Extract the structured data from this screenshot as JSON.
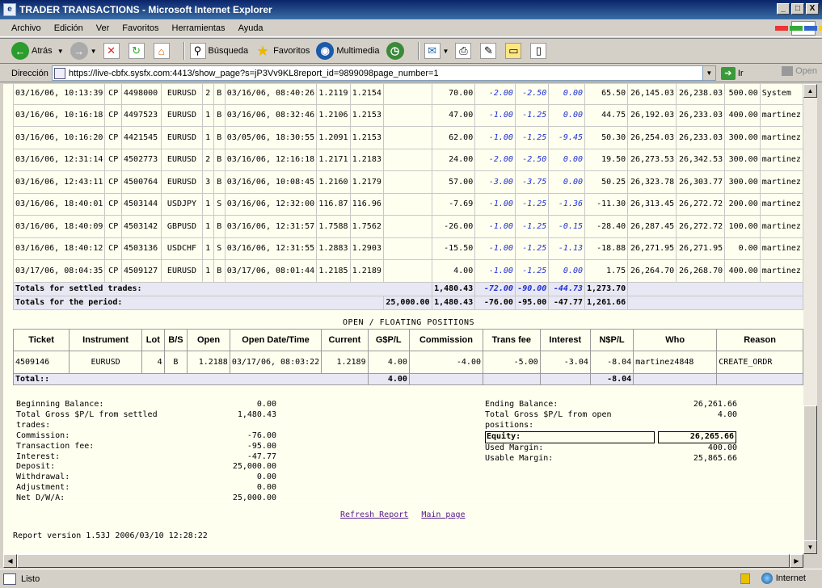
{
  "window": {
    "title": "TRADER TRANSACTIONS - Microsoft Internet Explorer",
    "btn_min": "_",
    "btn_max": "□",
    "btn_close": "X"
  },
  "menu": [
    "Archivo",
    "Edición",
    "Ver",
    "Favoritos",
    "Herramientas",
    "Ayuda"
  ],
  "toolbar": {
    "back": "Atrás",
    "search": "Búsqueda",
    "favorites": "Favoritos",
    "media": "Multimedia"
  },
  "address": {
    "label": "Dirección",
    "url": "https://live-cbfx.sysfx.com:4413/show_page?s=jP3Vv9KL8report_id=9899098page_number=1",
    "go": "Ir",
    "open": "Open"
  },
  "trades": [
    [
      "03/16/06, 10:13:39",
      "CP",
      "4498000",
      "EURUSD",
      "2",
      "B",
      "03/16/06, 08:40:26",
      "1.2119",
      "1.2154",
      "",
      "70.00",
      "-2.00",
      "-2.50",
      "0.00",
      "65.50",
      "26,145.03",
      "26,238.03",
      "500.00",
      "System"
    ],
    [
      "03/16/06, 10:16:18",
      "CP",
      "4497523",
      "EURUSD",
      "1",
      "B",
      "03/16/06, 08:32:46",
      "1.2106",
      "1.2153",
      "",
      "47.00",
      "-1.00",
      "-1.25",
      "0.00",
      "44.75",
      "26,192.03",
      "26,233.03",
      "400.00",
      "martinez"
    ],
    [
      "03/16/06, 10:16:20",
      "CP",
      "4421545",
      "EURUSD",
      "1",
      "B",
      "03/05/06, 18:30:55",
      "1.2091",
      "1.2153",
      "",
      "62.00",
      "-1.00",
      "-1.25",
      "-9.45",
      "50.30",
      "26,254.03",
      "26,233.03",
      "300.00",
      "martinez"
    ],
    [
      "03/16/06, 12:31:14",
      "CP",
      "4502773",
      "EURUSD",
      "2",
      "B",
      "03/16/06, 12:16:18",
      "1.2171",
      "1.2183",
      "",
      "24.00",
      "-2.00",
      "-2.50",
      "0.00",
      "19.50",
      "26,273.53",
      "26,342.53",
      "300.00",
      "martinez"
    ],
    [
      "03/16/06, 12:43:11",
      "CP",
      "4500764",
      "EURUSD",
      "3",
      "B",
      "03/16/06, 10:08:45",
      "1.2160",
      "1.2179",
      "",
      "57.00",
      "-3.00",
      "-3.75",
      "0.00",
      "50.25",
      "26,323.78",
      "26,303.77",
      "300.00",
      "martinez"
    ],
    [
      "03/16/06, 18:40:01",
      "CP",
      "4503144",
      "USDJPY",
      "1",
      "S",
      "03/16/06, 12:32:00",
      "116.87",
      "116.96",
      "",
      "-7.69",
      "-1.00",
      "-1.25",
      "-1.36",
      "-11.30",
      "26,313.45",
      "26,272.72",
      "200.00",
      "martinez"
    ],
    [
      "03/16/06, 18:40:09",
      "CP",
      "4503142",
      "GBPUSD",
      "1",
      "B",
      "03/16/06, 12:31:57",
      "1.7588",
      "1.7562",
      "",
      "-26.00",
      "-1.00",
      "-1.25",
      "-0.15",
      "-28.40",
      "26,287.45",
      "26,272.72",
      "100.00",
      "martinez"
    ],
    [
      "03/16/06, 18:40:12",
      "CP",
      "4503136",
      "USDCHF",
      "1",
      "S",
      "03/16/06, 12:31:55",
      "1.2883",
      "1.2903",
      "",
      "-15.50",
      "-1.00",
      "-1.25",
      "-1.13",
      "-18.88",
      "26,271.95",
      "26,271.95",
      "0.00",
      "martinez"
    ],
    [
      "03/17/06, 08:04:35",
      "CP",
      "4509127",
      "EURUSD",
      "1",
      "B",
      "03/17/06, 08:01:44",
      "1.2185",
      "1.2189",
      "",
      "4.00",
      "-1.00",
      "-1.25",
      "0.00",
      "1.75",
      "26,264.70",
      "26,268.70",
      "400.00",
      "martinez"
    ]
  ],
  "totals_settled": {
    "label": "Totals for settled trades:",
    "gpl": "1,480.43",
    "commission": "-72.00",
    "fee": "-90.00",
    "interest": "-44.73",
    "npl": "1,273.70"
  },
  "totals_period": {
    "label": "Totals for the period:",
    "deposit": "25,000.00",
    "gpl": "1,480.43",
    "commission": "-76.00",
    "fee": "-95.00",
    "interest": "-47.77",
    "npl": "1,261.66"
  },
  "open_positions": {
    "title": "OPEN / FLOATING POSITIONS",
    "headers": [
      "Ticket",
      "Instrument",
      "Lot",
      "B/S",
      "Open",
      "Open Date/Time",
      "Current",
      "G$P/L",
      "Commission",
      "Trans fee",
      "Interest",
      "N$P/L",
      "Who",
      "Reason"
    ],
    "rows": [
      [
        "4509146",
        "EURUSD",
        "4",
        "B",
        "1.2188",
        "03/17/06, 08:03:22",
        "1.2189",
        "4.00",
        "-4.00",
        "-5.00",
        "-3.04",
        "-8.04",
        "martinez4848",
        "CREATE_ORDR"
      ]
    ],
    "total": {
      "label": "Total::",
      "gpl": "4.00",
      "npl": "-8.04"
    }
  },
  "summary_left": [
    {
      "label": "Beginning Balance:",
      "value": "0.00"
    },
    {
      "label": "Total Gross $P/L from settled trades:",
      "value": "1,480.43"
    },
    {
      "label": "Commission:",
      "value": "-76.00"
    },
    {
      "label": "Transaction fee:",
      "value": "-95.00"
    },
    {
      "label": "Interest:",
      "value": "-47.77"
    },
    {
      "label": "Deposit:",
      "value": "25,000.00"
    },
    {
      "label": "Withdrawal:",
      "value": "0.00"
    },
    {
      "label": "Adjustment:",
      "value": "0.00"
    },
    {
      "label": "Net D/W/A:",
      "value": "25,000.00"
    }
  ],
  "summary_right": {
    "ending_label": "Ending Balance:",
    "ending_value": "26,261.66",
    "gross_open_label": "Total Gross $P/L from open positions:",
    "gross_open_value": "4.00",
    "equity_label": "Equity:",
    "equity_value": "26,265.66",
    "used_margin_label": "Used Margin:",
    "used_margin_value": "400.00",
    "usable_margin_label": "Usable Margin:",
    "usable_margin_value": "25,865.66"
  },
  "links": {
    "refresh": "Refresh Report",
    "main": "Main page"
  },
  "report_version": "Report version 1.53J 2006/03/10 12:28:22",
  "status": {
    "text": "Listo",
    "zone": "Internet"
  }
}
